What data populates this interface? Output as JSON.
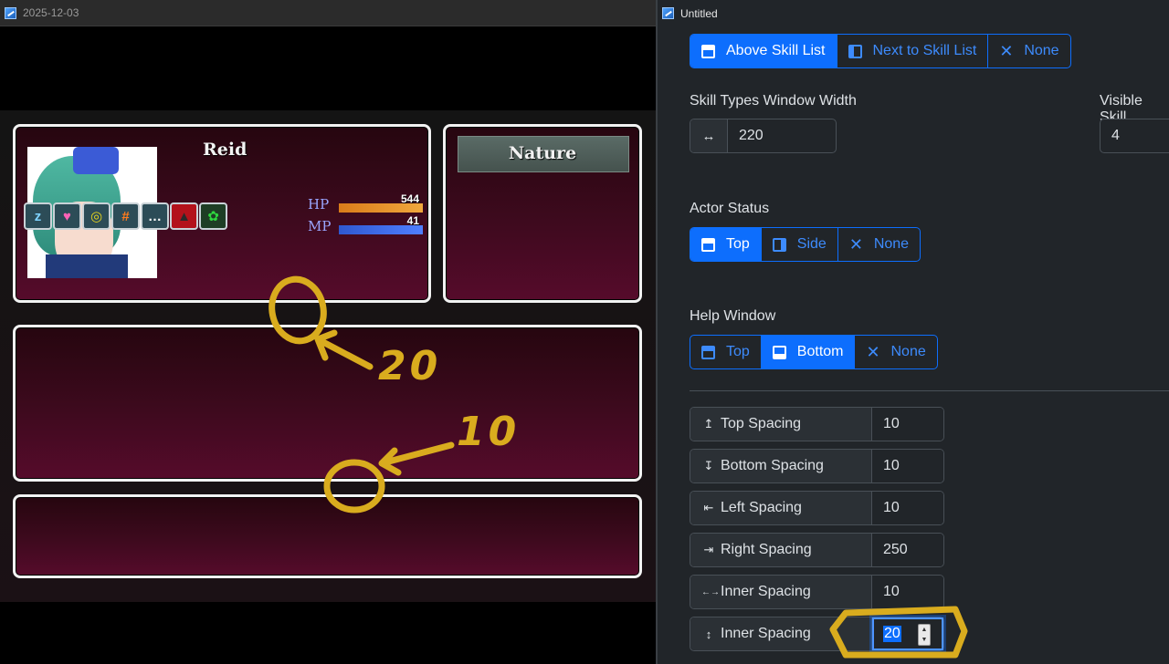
{
  "game": {
    "title": "2025-12-03",
    "actor": {
      "name": "Reid",
      "hp_label": "HP",
      "hp_value": "544",
      "hp_fill": 1.0,
      "mp_label": "MP",
      "mp_value": "41",
      "mp_fill": 1.0,
      "status_icons": [
        "sleep-icon",
        "charm-icon",
        "confusion-icon",
        "rage-icon",
        "silence-icon",
        "darkness-icon",
        "poison-icon"
      ]
    },
    "skill_type_command": "Nature",
    "annotation_20": "20",
    "annotation_10": "10",
    "annotation_color": "#d9ac1e"
  },
  "editor": {
    "title": "Untitled",
    "skill_window_position": {
      "options": [
        "Above Skill List",
        "Next to Skill List",
        "None"
      ],
      "selected": "Above Skill List"
    },
    "skill_types_width": {
      "label": "Skill Types Window Width",
      "icon": "↔",
      "value": "220"
    },
    "visible_skill": {
      "label": "Visible Skill",
      "value": "4"
    },
    "actor_status": {
      "label": "Actor Status",
      "options": [
        "Top",
        "Side",
        "None"
      ],
      "selected": "Top"
    },
    "help_window": {
      "label": "Help Window",
      "options": [
        "Top",
        "Bottom",
        "None"
      ],
      "selected": "Bottom"
    },
    "spacing": [
      {
        "icon": "↥",
        "label": "Top Spacing",
        "value": "10"
      },
      {
        "icon": "↧",
        "label": "Bottom Spacing",
        "value": "10"
      },
      {
        "icon": "⇤",
        "label": "Left Spacing",
        "value": "10"
      },
      {
        "icon": "⇥",
        "label": "Right Spacing",
        "value": "250"
      },
      {
        "icon": "←→",
        "label": "Inner Spacing",
        "value": "10"
      },
      {
        "icon": "↕",
        "label": "Inner Spacing",
        "value": "20"
      }
    ],
    "accent_color": "#0d6efd"
  }
}
